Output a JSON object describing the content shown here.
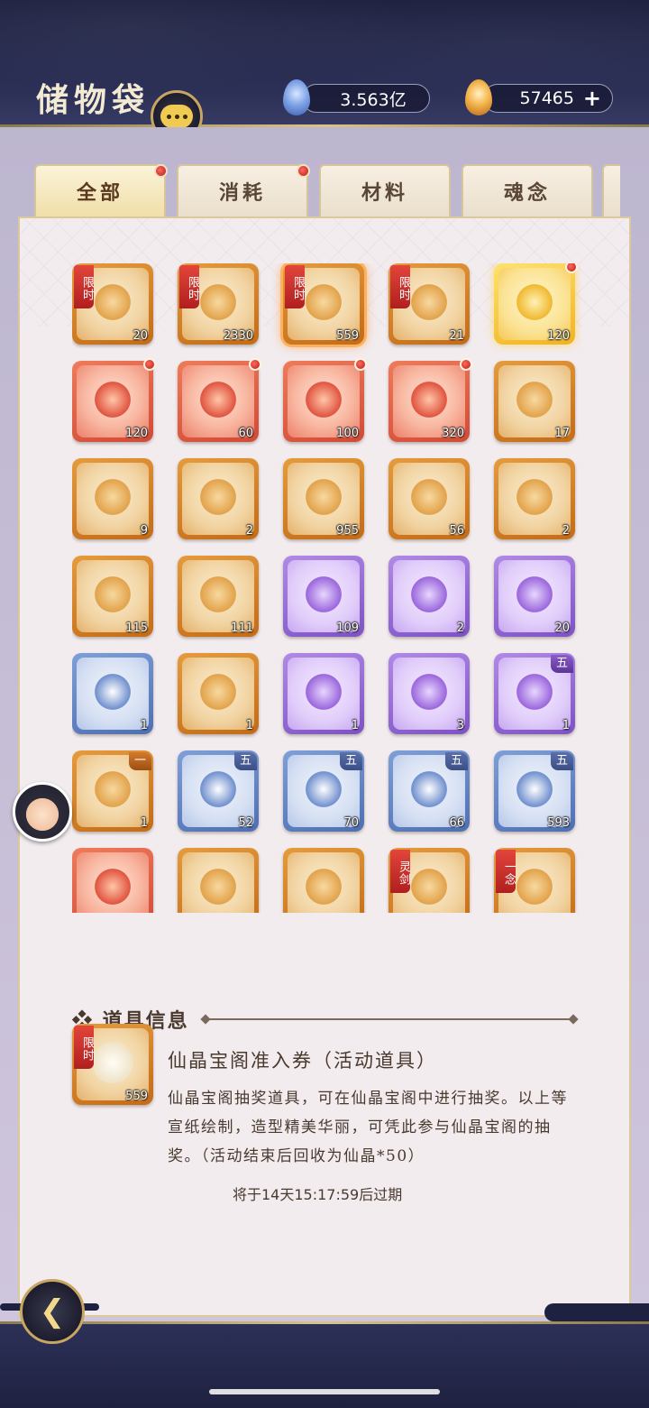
{
  "header": {
    "title": "储物袋"
  },
  "currencies": [
    {
      "value": "3.563亿",
      "icon": "spirit-gem-icon"
    },
    {
      "value": "57465",
      "icon": "flame-coin-icon",
      "add": "+"
    }
  ],
  "tabs": [
    {
      "label": "全部",
      "active": true,
      "dot": true
    },
    {
      "label": "消耗",
      "active": false,
      "dot": true
    },
    {
      "label": "材料",
      "active": false,
      "dot": false
    },
    {
      "label": "魂念",
      "active": false,
      "dot": false
    }
  ],
  "items": [
    {
      "count": "20",
      "rarity": "orange",
      "tag": "限时"
    },
    {
      "count": "2330",
      "rarity": "orange",
      "tag": "限时"
    },
    {
      "count": "559",
      "rarity": "orange",
      "tag": "限时",
      "selected": true
    },
    {
      "count": "21",
      "rarity": "orange",
      "tag": "限时"
    },
    {
      "count": "120",
      "rarity": "gold",
      "dot": true
    },
    {
      "count": "120",
      "rarity": "red",
      "dot": true
    },
    {
      "count": "60",
      "rarity": "red",
      "dot": true
    },
    {
      "count": "100",
      "rarity": "red",
      "dot": true
    },
    {
      "count": "320",
      "rarity": "red",
      "dot": true
    },
    {
      "count": "17",
      "rarity": "orange"
    },
    {
      "count": "9",
      "rarity": "orange"
    },
    {
      "count": "2",
      "rarity": "orange"
    },
    {
      "count": "955",
      "rarity": "orange"
    },
    {
      "count": "56",
      "rarity": "orange"
    },
    {
      "count": "2",
      "rarity": "orange"
    },
    {
      "count": "115",
      "rarity": "orange"
    },
    {
      "count": "111",
      "rarity": "orange"
    },
    {
      "count": "109",
      "rarity": "purple"
    },
    {
      "count": "2",
      "rarity": "purple"
    },
    {
      "count": "20",
      "rarity": "purple"
    },
    {
      "count": "1",
      "rarity": "blue"
    },
    {
      "count": "1",
      "rarity": "orange"
    },
    {
      "count": "1",
      "rarity": "purple"
    },
    {
      "count": "3",
      "rarity": "purple"
    },
    {
      "count": "1",
      "rarity": "purple",
      "grade": "五"
    },
    {
      "count": "1",
      "rarity": "orange",
      "grade": "一"
    },
    {
      "count": "52",
      "rarity": "blue",
      "grade": "五"
    },
    {
      "count": "70",
      "rarity": "blue",
      "grade": "五"
    },
    {
      "count": "66",
      "rarity": "blue",
      "grade": "五"
    },
    {
      "count": "593",
      "rarity": "blue",
      "grade": "五"
    },
    {
      "count": "",
      "rarity": "red"
    },
    {
      "count": "",
      "rarity": "orange"
    },
    {
      "count": "",
      "rarity": "orange"
    },
    {
      "count": "",
      "rarity": "orange",
      "tag": "灵剑"
    },
    {
      "count": "",
      "rarity": "orange",
      "tag": "一念"
    }
  ],
  "info": {
    "section_title": "❖ 道具信息",
    "item_name": "仙晶宝阁准入券（活动道具）",
    "item_count": "559",
    "item_tag": "限时",
    "description": "仙晶宝阁抽奖道具，可在仙晶宝阁中进行抽奖。以上等宣纸绘制，造型精美华丽，可凭此参与仙晶宝阁的抽奖。（活动结束后回收为仙晶*50）",
    "expire": "将于14天15:17:59后过期"
  },
  "colors": {
    "accent_gold": "#d9c48a",
    "header_bg": "#2d3158",
    "panel_bg": "#f2ecef"
  }
}
